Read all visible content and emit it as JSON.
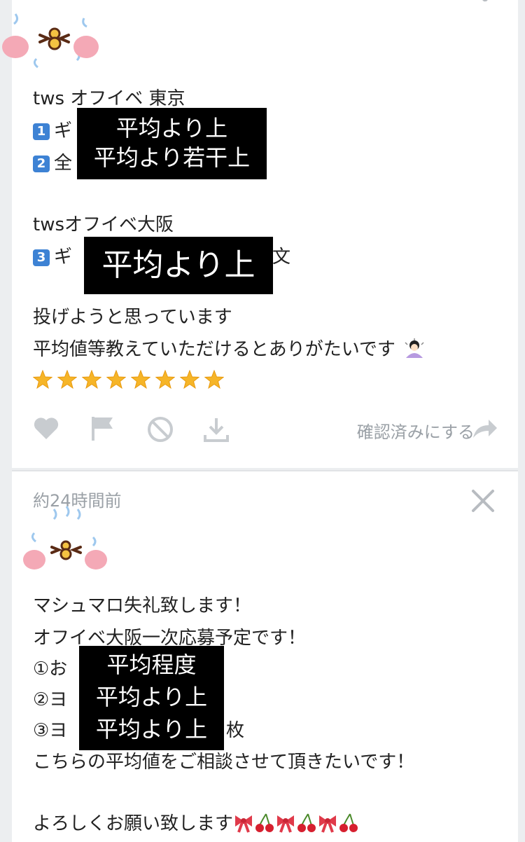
{
  "card1": {
    "lines": {
      "l1": "tws オフイベ 東京",
      "l2_badge": "1",
      "l2_prefix": "ギ",
      "l3_badge": "2",
      "l3_prefix": "全",
      "l4": "twsオフイベ大阪",
      "l5_badge": "3",
      "l5_prefix": "ギ",
      "l5_suffix": "文",
      "l6": "投げようと思っています",
      "l7": "平均値等教えていただけるとありがたいです"
    },
    "censor1": {
      "a": "平均より上",
      "b": "平均より若干上"
    },
    "censor2": {
      "a": "平均より上"
    },
    "actions": {
      "confirm_label": "確認済みにする"
    }
  },
  "card2": {
    "timestamp": "約24時間前",
    "lines": {
      "l1": "マシュマロ失礼致します！",
      "l2": "オフイベ大阪一次応募予定です！",
      "l3": "①お",
      "l4": "②ヨ",
      "l5": "③ヨ",
      "l5_suffix": "枚",
      "l6": "こちらの平均値をご相談させて頂きたいです！",
      "l7": "よろしくお願い致します"
    },
    "censor": {
      "a": "平均程度",
      "b": "平均より上",
      "c": "平均より上"
    }
  },
  "colors": {
    "censor_bg": "#000000",
    "icon_gray": "#c8ccd0",
    "badge_blue": "#3d82d4"
  },
  "icons": [
    "heart-icon",
    "flag-icon",
    "block-icon",
    "download-icon",
    "share-arrow-icon",
    "close-icon",
    "star-emoji-icon",
    "ribbon-emoji-icon",
    "cherry-emoji-icon"
  ]
}
